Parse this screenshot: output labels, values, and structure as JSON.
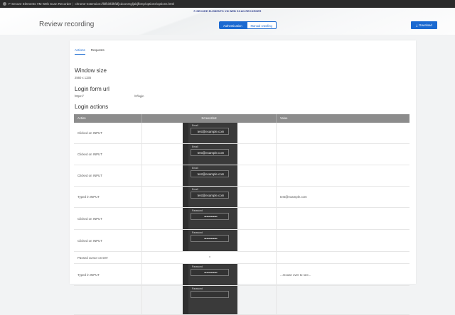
{
  "browser": {
    "title": "F-Secure Elements VM Web Scan Recorder",
    "url": "chrome-extension://lkfkihfdhfdfjcdoonmgljabjfbmp/options/options.html"
  },
  "header": {
    "brand": "F-SECURE ELEMENTS VM WEB SCAN RECORDER",
    "page_title": "Review recording",
    "mode_tabs": [
      "Authentication",
      "Manual crawling"
    ],
    "download_label": "Download",
    "colors": {
      "accent": "#1b6ad1"
    }
  },
  "tabs": [
    "Actions",
    "Requests"
  ],
  "window_size": {
    "title": "Window size",
    "value": "2560 x 1335"
  },
  "login_url": {
    "title": "Login form url",
    "value": "https://",
    "path": "/#/login"
  },
  "login_actions": {
    "title": "Login actions",
    "columns": [
      "Action",
      "Screenshot",
      "Value"
    ],
    "rows": [
      {
        "action": "Clicked on INPUT",
        "thumb_label": "Email",
        "thumb_value": "test@example.com",
        "value": ""
      },
      {
        "action": "Clicked on INPUT",
        "thumb_label": "Email",
        "thumb_value": "test@example.com",
        "value": ""
      },
      {
        "action": "Clicked on INPUT",
        "thumb_label": "Email",
        "thumb_value": "test@example.com",
        "value": ""
      },
      {
        "action": "Typed in INPUT",
        "thumb_label": "Email",
        "thumb_value": "test@example.com",
        "value": "test@example.com"
      },
      {
        "action": "Clicked on INPUT",
        "thumb_label": "Password",
        "thumb_value": "••••••••••••",
        "value": ""
      },
      {
        "action": "Clicked on INPUT",
        "thumb_label": "Password",
        "thumb_value": "••••••••••••",
        "value": ""
      },
      {
        "action": "Passed cursor on DIV",
        "thumb_label": "",
        "thumb_value": "",
        "value": ""
      },
      {
        "action": "Typed in INPUT",
        "thumb_label": "Password",
        "thumb_value": "••••••••••••",
        "value": "...mouse over to see..."
      },
      {
        "action": "",
        "thumb_label": "Password",
        "thumb_value": "",
        "value": ""
      }
    ]
  }
}
